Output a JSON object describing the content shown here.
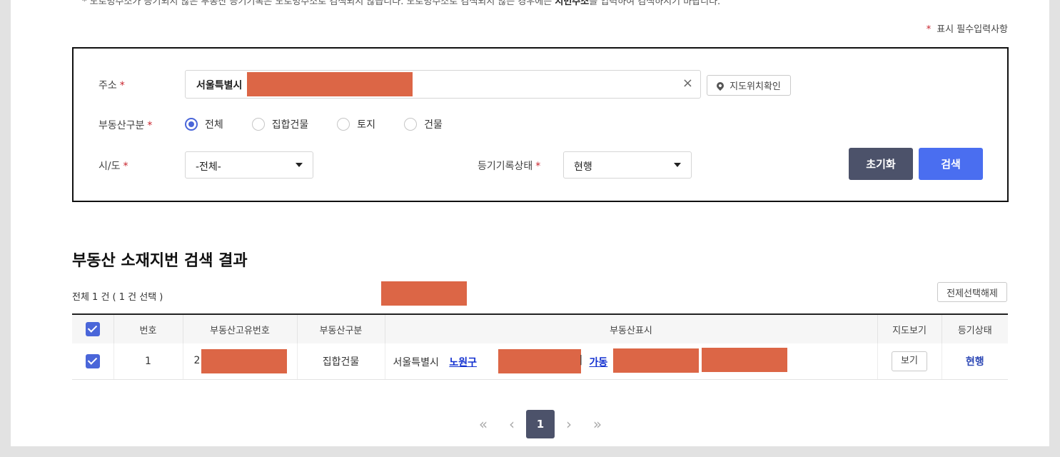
{
  "notice": {
    "text_prefix": "* 도로명주소가 등기되지 않은 부동산 등기기록은 도로명주소로 검색되지 않습니다. 도로명주소로 검색되지 않는 경우에는 ",
    "text_bold": "지번주소",
    "text_suffix": "를 입력하여 검색하시기 바랍니다."
  },
  "required_note": {
    "star": "*",
    "label": "표시 필수입력사항"
  },
  "search": {
    "address_label": "주소",
    "address_value": "서울특별시",
    "clear_icon": "×",
    "map_button": "지도위치확인",
    "type_label": "부동산구분",
    "type_options": [
      "전체",
      "집합건물",
      "토지",
      "건물"
    ],
    "type_selected": "전체",
    "region_label": "시/도",
    "region_value": "-전체-",
    "status_label": "등기기록상태",
    "status_value": "현행",
    "reset_button": "초기화",
    "search_button": "검색"
  },
  "results": {
    "title": "부동산 소재지번 검색 결과",
    "count_text": "전체 1 건 ( 1 건 선택 )",
    "deselect_button": "전제선택해제",
    "columns": [
      "번호",
      "부동산고유번호",
      "부동산구분",
      "부동산표시",
      "지도보기",
      "등기상태"
    ],
    "rows": [
      {
        "number": "1",
        "unique_id_prefix": "2",
        "type": "집합건물",
        "addr_city": "서울특별시",
        "addr_district": "노원구",
        "addr_sep": "|",
        "addr_dong": "가동",
        "map_button": "보기",
        "status": "현행"
      }
    ]
  },
  "pagination": {
    "first": "«",
    "prev": "‹",
    "current": "1",
    "next": "›",
    "last": "»"
  },
  "colors": {
    "accent": "#4a66d9",
    "search_btn": "#4a6ef0",
    "reset_btn": "#4c526a",
    "redaction": "#dc6646",
    "required": "#c8232c"
  }
}
